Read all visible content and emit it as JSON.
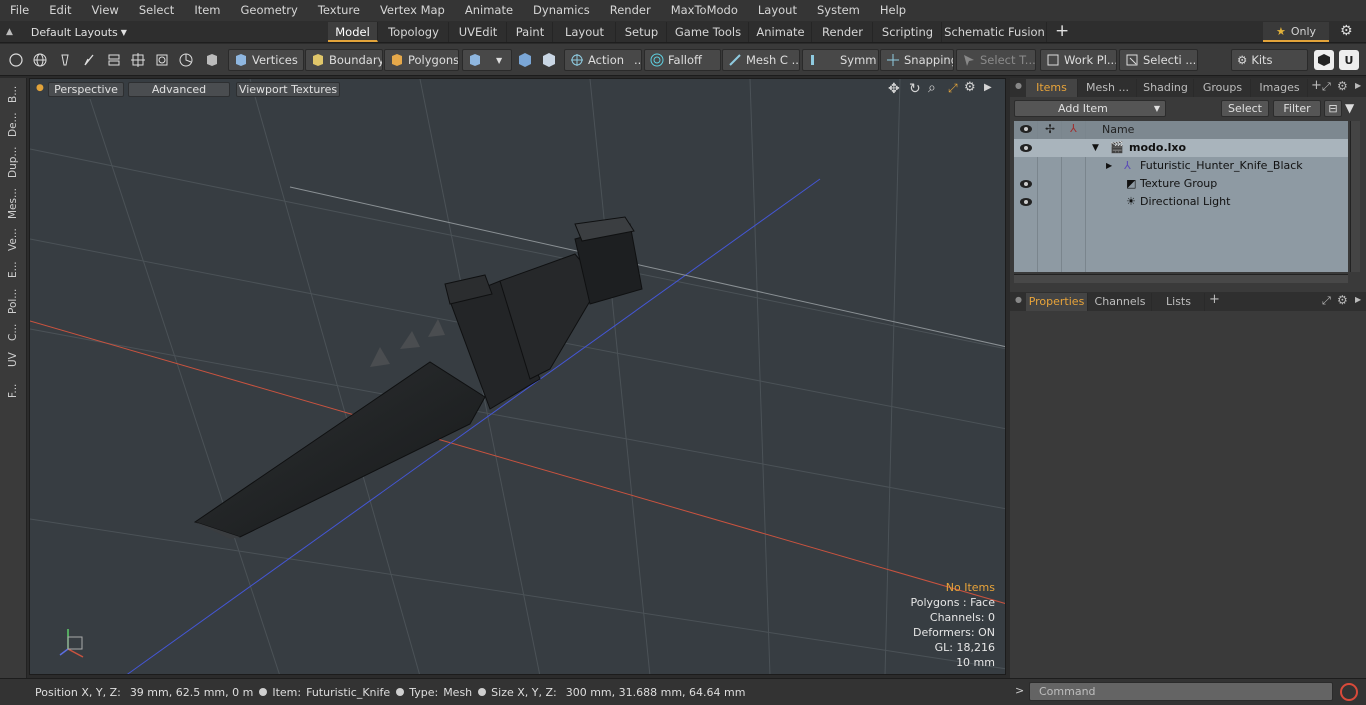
{
  "menu": [
    "File",
    "Edit",
    "View",
    "Select",
    "Item",
    "Geometry",
    "Texture",
    "Vertex Map",
    "Animate",
    "Dynamics",
    "Render",
    "MaxToModo",
    "Layout",
    "System",
    "Help"
  ],
  "layout_selector": "Default Layouts",
  "layout_tabs": [
    "Model",
    "Topology",
    "UVEdit",
    "Paint",
    "Layout",
    "Setup",
    "Game Tools",
    "Animate",
    "Render",
    "Scripting",
    "Schematic Fusion"
  ],
  "only_label": "Only",
  "toolbar": {
    "vertices": "Vertices",
    "boundary": "Boundary",
    "polygons": "Polygons",
    "action": "Action",
    "falloff": "Falloff",
    "mesh": "Mesh C ...",
    "symmetry": "Symm ...",
    "snapping": "Snapping",
    "select_t": "Select T...",
    "workplane": "Work Pl...",
    "selection": "Selecti ...",
    "kits": "Kits"
  },
  "left_tabs": [
    "B...",
    "De...",
    "Dup...",
    "Mes...",
    "Ve...",
    "E...",
    "Pol...",
    "C...",
    "UV",
    "F..."
  ],
  "viewport": {
    "perspective": "Perspective",
    "advanced": "Advanced",
    "viewport_textures": "Viewport Textures",
    "no_items": "No Items",
    "polygons": "Polygons : Face",
    "channels": "Channels: 0",
    "deformers": "Deformers: ON",
    "gl": "GL: 18,216",
    "scale": "10 mm"
  },
  "status": {
    "position_label": "Position X, Y, Z:",
    "position_value": "39 mm, 62.5 mm, 0 m",
    "item_label": "Item:",
    "item_value": "Futuristic_Knife",
    "type_label": "Type:",
    "type_value": "Mesh",
    "size_label": "Size X, Y, Z:",
    "size_value": "300 mm, 31.688 mm, 64.64 mm"
  },
  "items_panel": {
    "tabs": [
      "Items",
      "Mesh ...",
      "Shading",
      "Groups",
      "Images"
    ],
    "add_item": "Add Item",
    "select": "Select",
    "filter": "Filter",
    "name_header": "Name",
    "rows": [
      "modo.lxo",
      "Futuristic_Hunter_Knife_Black",
      "Texture Group",
      "Directional Light"
    ]
  },
  "properties_panel": {
    "tabs": [
      "Properties",
      "Channels",
      "Lists"
    ]
  },
  "command": {
    "placeholder": "Command"
  },
  "colors": {
    "accent": "#e8a43a",
    "x_axis": "#d2553f",
    "z_axis": "#4a5fd8"
  }
}
